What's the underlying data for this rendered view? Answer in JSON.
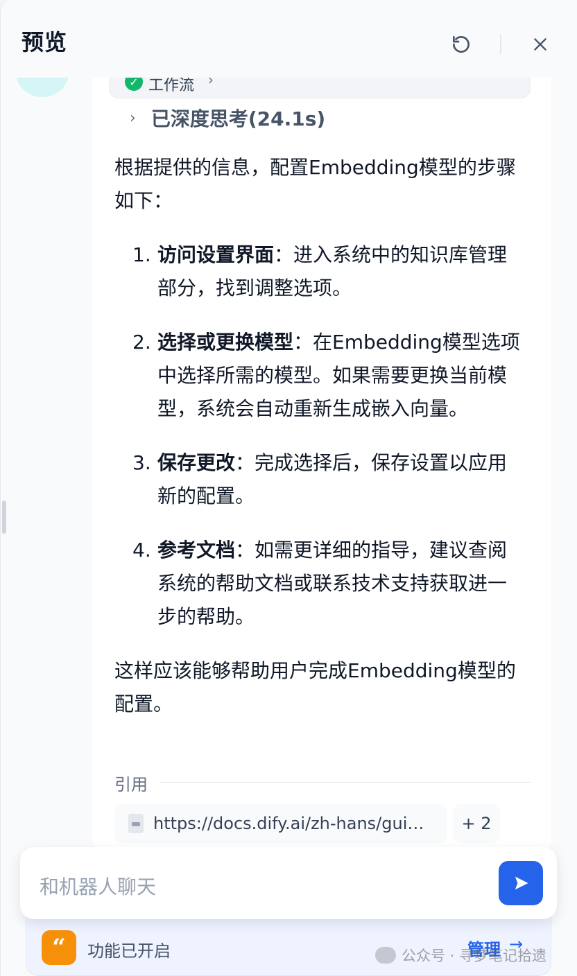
{
  "header": {
    "title": "预览",
    "refresh_icon": "refresh-icon",
    "close_icon": "close-icon"
  },
  "message": {
    "workflow_label": "工作流",
    "thinking_label": "已深度思考(24.1s)",
    "intro": "根据提供的信息，配置Embedding模型的步骤如下：",
    "steps": [
      {
        "num": "1.",
        "title": "访问设置界面",
        "text": "：进入系统中的知识库管理部分，找到调整选项。"
      },
      {
        "num": "2.",
        "title": "选择或更换模型",
        "text": "：在Embedding模型选项中选择所需的模型。如果需要更换当前模型，系统会自动重新生成嵌入向量。"
      },
      {
        "num": "3.",
        "title": "保存更改",
        "text": "：完成选择后，保存设置以应用新的配置。"
      },
      {
        "num": "4.",
        "title": "参考文档",
        "text": "：如需更详细的指导，建议查阅系统的帮助文档或联系技术支持获取进一步的帮助。"
      }
    ],
    "conclusion": "这样应该能够帮助用户完成Embedding模型的配置。",
    "citation_label": "引用",
    "citation_url": "https://docs.dify.ai/zh-hans/guide...",
    "citation_more": "+ 2"
  },
  "input": {
    "placeholder": "和机器人聊天"
  },
  "feature_bar": {
    "text": "功能已开启",
    "manage_label": "管理",
    "manage_arrow": "→"
  },
  "watermark": {
    "text": "公众号 · 寻梦笔记拾遗"
  },
  "colors": {
    "accent": "#2563eb",
    "success": "#12b76a",
    "feature_icon": "#f79009"
  }
}
